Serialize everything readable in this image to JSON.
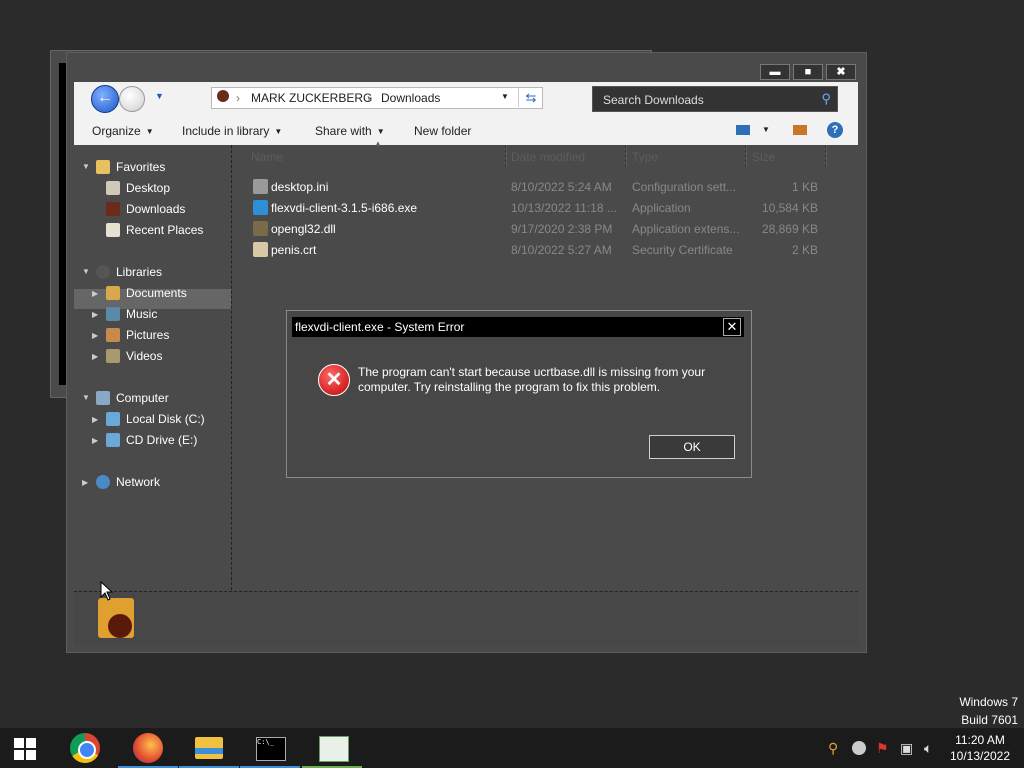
{
  "explorer": {
    "caption_min": "▬",
    "caption_max": "■",
    "caption_close": "✖",
    "breadcrumb": [
      "MARK ZUCKERBERG",
      "Downloads"
    ],
    "breadcrumb_sep": "›",
    "search_placeholder": "Search Downloads",
    "toolbar": {
      "organize": "Organize",
      "include_in_library": "Include in library",
      "share_with": "Share with",
      "new_folder": "New folder"
    },
    "columns": [
      "Name",
      "Date modified",
      "Type",
      "Size"
    ],
    "nav": {
      "favorites": "Favorites",
      "desktop": "Desktop",
      "downloads": "Downloads",
      "recent_places": "Recent Places",
      "libraries": "Libraries",
      "documents": "Documents",
      "music": "Music",
      "pictures": "Pictures",
      "videos": "Videos",
      "computer": "Computer",
      "local_disk": "Local Disk (C:)",
      "cd_drive": "CD Drive (E:)",
      "network": "Network"
    },
    "files": [
      {
        "name": "desktop.ini",
        "date": "8/10/2022 5:24 AM",
        "type": "Configuration sett...",
        "size": "1 KB",
        "icon": "settings-file-icon",
        "color": "#9a9a9a"
      },
      {
        "name": "flexvdi-client-3.1.5-i686.exe",
        "date": "10/13/2022 11:18 ...",
        "type": "Application",
        "size": "10,584 KB",
        "icon": "flexvdi-app-icon",
        "color": "#2f8fd6"
      },
      {
        "name": "opengl32.dll",
        "date": "9/17/2020 2:38 PM",
        "type": "Application extens...",
        "size": "28,869 KB",
        "icon": "dll-file-icon",
        "color": "#7a6a4a"
      },
      {
        "name": "penis.crt",
        "date": "8/10/2022 5:27 AM",
        "type": "Security Certificate",
        "size": "2 KB",
        "icon": "certificate-icon",
        "color": "#d8c8a8"
      }
    ]
  },
  "dialog": {
    "title": "flexvdi-client.exe - System Error",
    "message": "The program can't start because ucrtbase.dll is missing from your computer. Try reinstalling the program to fix this problem.",
    "ok_label": "OK",
    "close_glyph": "✕",
    "error_glyph": "✕"
  },
  "watermark": {
    "line1": "Windows 7",
    "line2": "Build 7601"
  },
  "taskbar": {
    "apps": [
      "chrome-icon",
      "firefox-icon",
      "file-explorer-icon",
      "command-prompt-icon",
      "notepad-icon"
    ],
    "time": "11:20 AM",
    "date": "10/13/2022"
  }
}
